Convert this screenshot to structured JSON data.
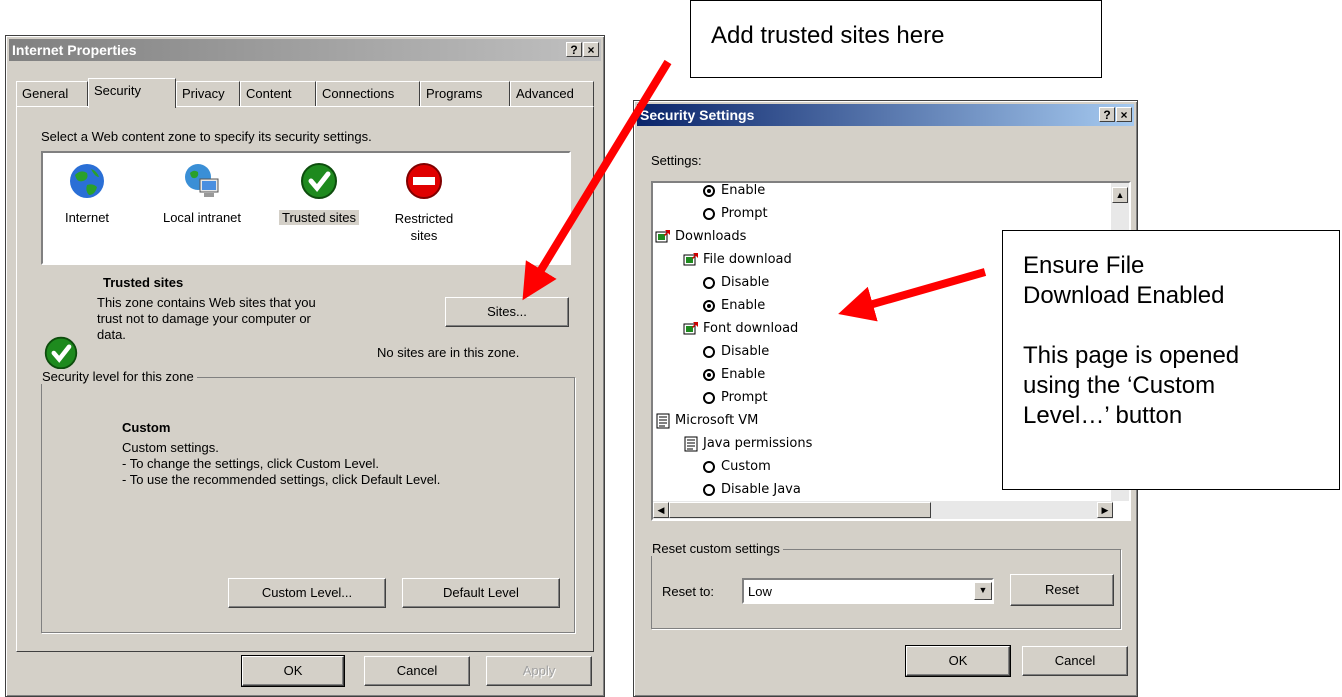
{
  "internet_properties": {
    "title": "Internet Properties",
    "help_glyph": "?",
    "close_glyph": "×",
    "tabs": [
      "General",
      "Security",
      "Privacy",
      "Content",
      "Connections",
      "Programs",
      "Advanced"
    ],
    "selected_tab": "Security",
    "zone_prompt": "Select a Web content zone to specify its security settings.",
    "zones": [
      {
        "label": "Internet",
        "icon": "globe-icon"
      },
      {
        "label": "Local intranet",
        "icon": "intranet-icon"
      },
      {
        "label": "Trusted sites",
        "icon": "trusted-check-icon"
      },
      {
        "label": "Restricted",
        "label2": "sites",
        "icon": "restricted-icon"
      }
    ],
    "zone_title": "Trusted sites",
    "zone_desc_1": "This zone contains Web sites that you",
    "zone_desc_2": "trust not to damage your computer or",
    "zone_desc_3": "data.",
    "sites_button": "Sites...",
    "sites_status": "No sites are in this zone.",
    "level_group_label": "Security level for this zone",
    "level_title": "Custom",
    "level_desc_1": "Custom settings.",
    "level_desc_2": "- To change the settings, click Custom Level.",
    "level_desc_3": "- To use the recommended settings, click Default Level.",
    "custom_level_button": "Custom Level...",
    "default_level_button": "Default Level",
    "ok": "OK",
    "cancel": "Cancel",
    "apply": "Apply"
  },
  "security_settings": {
    "title": "Security Settings",
    "help_glyph": "?",
    "close_glyph": "×",
    "settings_label": "Settings:",
    "tree": [
      {
        "type": "radio",
        "label": "Enable",
        "checked": true
      },
      {
        "type": "radio",
        "label": "Prompt",
        "checked": false
      },
      {
        "type": "folder",
        "label": "Downloads"
      },
      {
        "type": "folder",
        "label": "File download"
      },
      {
        "type": "radio",
        "label": "Disable",
        "checked": false
      },
      {
        "type": "radio",
        "label": "Enable",
        "checked": true
      },
      {
        "type": "folder",
        "label": "Font download"
      },
      {
        "type": "radio",
        "label": "Disable",
        "checked": false
      },
      {
        "type": "radio",
        "label": "Enable",
        "checked": true
      },
      {
        "type": "radio",
        "label": "Prompt",
        "checked": false
      },
      {
        "type": "doc",
        "label": "Microsoft VM"
      },
      {
        "type": "doc",
        "label": "Java permissions"
      },
      {
        "type": "radio",
        "label": "Custom",
        "checked": false
      },
      {
        "type": "radio",
        "label": "Disable Java",
        "checked": false
      }
    ],
    "reset_group_label": "Reset custom settings",
    "reset_to_label": "Reset to:",
    "reset_value": "Low",
    "reset_button": "Reset",
    "ok": "OK",
    "cancel": "Cancel"
  },
  "callouts": {
    "trusted": "Add trusted sites here",
    "download_1": "Ensure File",
    "download_2": "Download Enabled",
    "opened_1": "This page is opened",
    "opened_2": "using the ‘Custom",
    "opened_3": "Level…’ button"
  },
  "colors": {
    "arrow": "#ff0000",
    "dialog_face": "#d4d0c8",
    "active_title": "#0a246a"
  }
}
